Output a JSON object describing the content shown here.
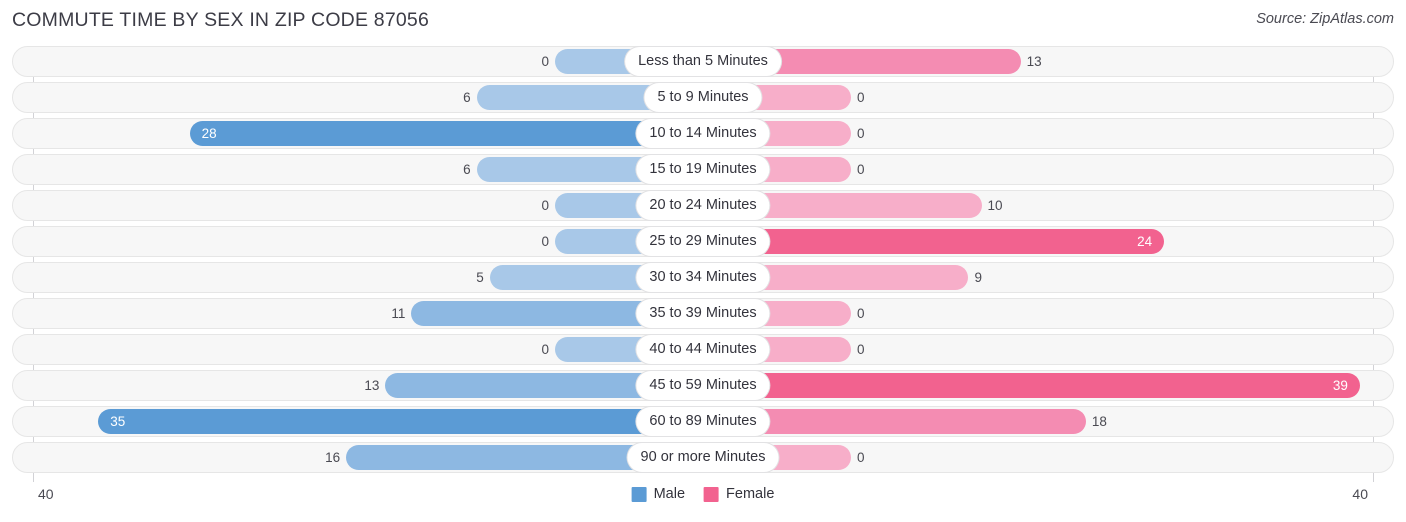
{
  "header": {
    "title": "COMMUTE TIME BY SEX IN ZIP CODE 87056",
    "source": "Source: ZipAtlas.com"
  },
  "axis": {
    "left_tick": "40",
    "right_tick": "40"
  },
  "legend": {
    "items": [
      {
        "label": "Male",
        "color": "#5b9bd5"
      },
      {
        "label": "Female",
        "color": "#f2628f"
      }
    ]
  },
  "colors": {
    "male_light": "#a8c8e8",
    "male_mid": "#8db8e2",
    "male_dark": "#5b9bd5",
    "female_light": "#f7aec9",
    "female_mid": "#f48cb2",
    "female_dark": "#f2628f",
    "track_bg": "#f7f7f7",
    "track_border": "#e6e6e6",
    "axis": "#d2d2d6",
    "text": "#4a4a52"
  },
  "chart_data": {
    "type": "bar",
    "subtype": "diverging-bidirectional",
    "title": "COMMUTE TIME BY SEX IN ZIP CODE 87056",
    "xlabel": "",
    "ylabel": "",
    "xlim": [
      40,
      40
    ],
    "axis_max": 40,
    "grid": false,
    "legend_position": "bottom-center",
    "categories": [
      "Less than 5 Minutes",
      "5 to 9 Minutes",
      "10 to 14 Minutes",
      "15 to 19 Minutes",
      "20 to 24 Minutes",
      "25 to 29 Minutes",
      "30 to 34 Minutes",
      "35 to 39 Minutes",
      "40 to 44 Minutes",
      "45 to 59 Minutes",
      "60 to 89 Minutes",
      "90 or more Minutes"
    ],
    "series": [
      {
        "name": "Male",
        "direction": "left",
        "color": "#5b9bd5",
        "values": [
          0,
          6,
          28,
          6,
          0,
          0,
          5,
          11,
          0,
          13,
          35,
          16
        ]
      },
      {
        "name": "Female",
        "direction": "right",
        "color": "#f2628f",
        "values": [
          13,
          0,
          0,
          0,
          10,
          24,
          9,
          0,
          0,
          39,
          18,
          0
        ]
      }
    ]
  }
}
